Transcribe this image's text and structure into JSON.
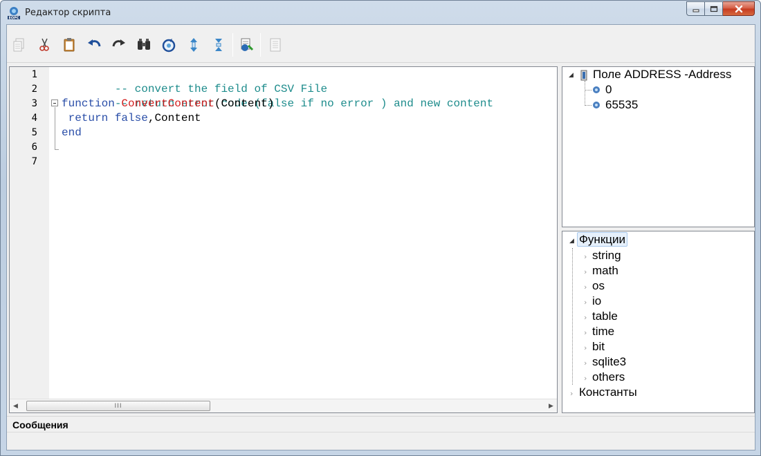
{
  "window": {
    "title": "Редактор скрипта",
    "app_icon": "eopc-logo-icon",
    "buttons": [
      "minimize-icon",
      "maximize-icon",
      "close-icon"
    ]
  },
  "toolbar": {
    "items": [
      {
        "name": "copy",
        "icon": "copy-icon",
        "enabled": false
      },
      {
        "name": "cut",
        "icon": "scissors-icon",
        "enabled": true
      },
      {
        "name": "paste",
        "icon": "clipboard-icon",
        "enabled": true
      },
      {
        "name": "undo",
        "icon": "undo-icon",
        "enabled": true
      },
      {
        "name": "redo",
        "icon": "redo-icon",
        "enabled": true
      },
      {
        "name": "find",
        "icon": "binoculars-icon",
        "enabled": true
      },
      {
        "name": "refresh",
        "icon": "refresh-icon",
        "enabled": true
      },
      {
        "name": "expand",
        "icon": "expand-icon",
        "enabled": true
      },
      {
        "name": "collapse",
        "icon": "collapse-icon",
        "enabled": true
      },
      {
        "name": "check",
        "icon": "check-script-icon",
        "enabled": true
      },
      {
        "name": "document",
        "icon": "document-icon",
        "enabled": false
      }
    ]
  },
  "editor": {
    "line_numbers": [
      "1",
      "2",
      "3",
      "4",
      "5",
      "6",
      "7"
    ],
    "lines": [
      [
        {
          "t": "-- convert the field of CSV File",
          "c": "comment"
        }
      ],
      [
        {
          "t": "-- return error code (false if no error ) and new content",
          "c": "comment"
        }
      ],
      [
        {
          "t": "function",
          "c": "kw"
        },
        {
          "t": " ",
          "c": "plain"
        },
        {
          "t": "ConvertContent",
          "c": "fn"
        },
        {
          "t": "(Content)",
          "c": "plain"
        }
      ],
      [
        {
          "t": " return",
          "c": "kw"
        },
        {
          "t": " ",
          "c": "plain"
        },
        {
          "t": "false",
          "c": "kw"
        },
        {
          "t": ",Content",
          "c": "plain"
        }
      ],
      [
        {
          "t": "end",
          "c": "kw"
        }
      ],
      [],
      []
    ],
    "scroll_grip": "III"
  },
  "fields_tree": {
    "root": "Поле ADDRESS -Address",
    "children": [
      "0",
      "65535"
    ]
  },
  "functions_tree": {
    "root": "Функции",
    "children": [
      "string",
      "math",
      "os",
      "io",
      "table",
      "time",
      "bit",
      "sqlite3",
      "others"
    ],
    "sibling": "Константы"
  },
  "messages": {
    "title": "Сообщения"
  }
}
